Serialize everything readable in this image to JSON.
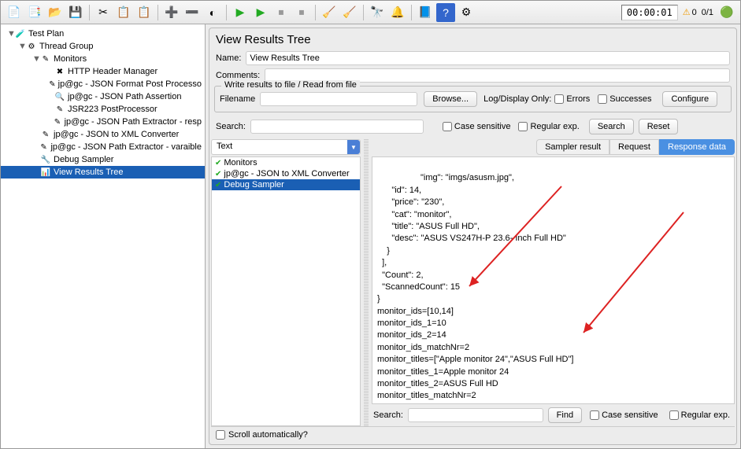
{
  "toolbar": {
    "timer": "00:00:01",
    "warn_count": "0",
    "run_count": "0/1"
  },
  "tree": [
    {
      "level": 0,
      "disc": "▼",
      "icon": "🧪",
      "label": "Test Plan"
    },
    {
      "level": 1,
      "disc": "▼",
      "icon": "⚙",
      "label": "Thread Group"
    },
    {
      "level": 2,
      "disc": "▼",
      "icon": "✎",
      "label": "Monitors"
    },
    {
      "level": 3,
      "disc": "",
      "icon": "✖",
      "label": "HTTP Header Manager"
    },
    {
      "level": 3,
      "disc": "",
      "icon": "✎",
      "label": "jp@gc - JSON Format Post Processo"
    },
    {
      "level": 3,
      "disc": "",
      "icon": "🔍",
      "label": "jp@gc - JSON Path Assertion"
    },
    {
      "level": 3,
      "disc": "",
      "icon": "✎",
      "label": "JSR223 PostProcessor"
    },
    {
      "level": 3,
      "disc": "",
      "icon": "✎",
      "label": "jp@gc - JSON Path Extractor - resp"
    },
    {
      "level": 2,
      "disc": "",
      "icon": "✎",
      "label": "jp@gc - JSON to XML Converter"
    },
    {
      "level": 2,
      "disc": "",
      "icon": "✎",
      "label": "jp@gc - JSON Path Extractor - varaible"
    },
    {
      "level": 2,
      "disc": "",
      "icon": "🔧",
      "label": "Debug Sampler"
    },
    {
      "level": 2,
      "disc": "",
      "icon": "📊",
      "label": "View Results Tree",
      "selected": true
    }
  ],
  "panel": {
    "title": "View Results Tree",
    "name_label": "Name:",
    "name_value": "View Results Tree",
    "comments_label": "Comments:",
    "file_legend": "Write results to file / Read from file",
    "filename_label": "Filename",
    "browse": "Browse...",
    "log_display": "Log/Display Only:",
    "errors": "Errors",
    "successes": "Successes",
    "configure": "Configure",
    "search_label": "Search:",
    "case_sensitive": "Case sensitive",
    "regular_exp": "Regular exp.",
    "search_btn": "Search",
    "reset_btn": "Reset",
    "renderer": "Text",
    "tabs": {
      "sampler": "Sampler result",
      "request": "Request",
      "response": "Response data"
    },
    "find_btn": "Find",
    "scroll_auto": "Scroll automatically?"
  },
  "result_list": [
    {
      "label": "Monitors"
    },
    {
      "label": "jp@gc - JSON to XML Converter"
    },
    {
      "label": "Debug Sampler",
      "selected": true
    }
  ],
  "response_text": "      \"img\": \"imgs/asusm.jpg\",\n      \"id\": 14,\n      \"price\": \"230\",\n      \"cat\": \"monitor\",\n      \"title\": \"ASUS Full HD\",\n      \"desc\": \"ASUS VS247H-P 23.6- Inch Full HD\"\n    }\n  ],\n  \"Count\": 2,\n  \"ScannedCount\": 15\n}\nmonitor_ids=[10,14]\nmonitor_ids_1=10\nmonitor_ids_2=14\nmonitor_ids_matchNr=2\nmonitor_titles=[\"Apple monitor 24\",\"ASUS Full HD\"]\nmonitor_titles_1=Apple monitor 24\nmonitor_titles_2=ASUS Full HD\nmonitor_titles_matchNr=2"
}
